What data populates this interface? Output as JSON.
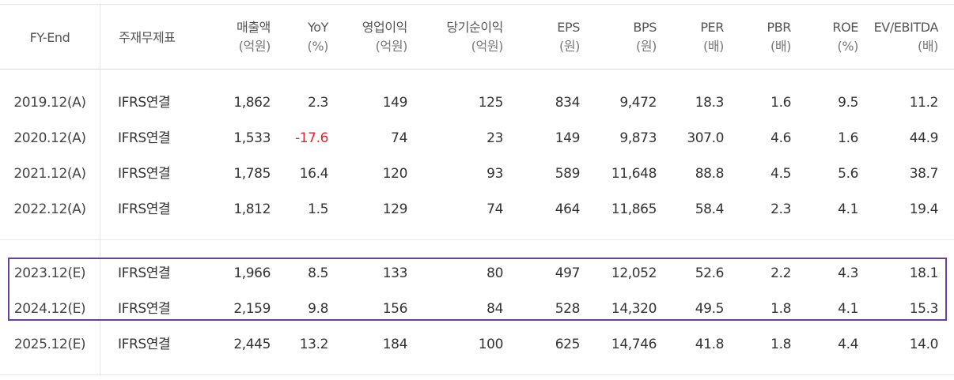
{
  "header": {
    "period": "FY-End",
    "standard": "주재무제표",
    "columns": [
      {
        "label": "매출액",
        "unit": "(억원)"
      },
      {
        "label": "YoY",
        "unit": "(%)"
      },
      {
        "label": "영업이익",
        "unit": "(억원)"
      },
      {
        "label": "당기순이익",
        "unit": "(억원)"
      },
      {
        "label": "EPS",
        "unit": "(원)"
      },
      {
        "label": "BPS",
        "unit": "(원)"
      },
      {
        "label": "PER",
        "unit": "(배)"
      },
      {
        "label": "PBR",
        "unit": "(배)"
      },
      {
        "label": "ROE",
        "unit": "(%)"
      },
      {
        "label": "EV/EBITDA",
        "unit": "(배)"
      }
    ]
  },
  "rows": [
    {
      "period": "2019.12(A)",
      "standard": "IFRS연결",
      "values": [
        "1,862",
        "2.3",
        "149",
        "125",
        "834",
        "9,472",
        "18.3",
        "1.6",
        "9.5",
        "11.2"
      ]
    },
    {
      "period": "2020.12(A)",
      "standard": "IFRS연결",
      "values": [
        "1,533",
        "-17.6",
        "74",
        "23",
        "149",
        "9,873",
        "307.0",
        "4.6",
        "1.6",
        "44.9"
      ]
    },
    {
      "period": "2021.12(A)",
      "standard": "IFRS연결",
      "values": [
        "1,785",
        "16.4",
        "120",
        "93",
        "589",
        "11,648",
        "88.8",
        "4.5",
        "5.6",
        "38.7"
      ]
    },
    {
      "period": "2022.12(A)",
      "standard": "IFRS연결",
      "values": [
        "1,812",
        "1.5",
        "129",
        "74",
        "464",
        "11,865",
        "58.4",
        "2.3",
        "4.1",
        "19.4"
      ]
    },
    {
      "period": "2023.12(E)",
      "standard": "IFRS연결",
      "values": [
        "1,966",
        "8.5",
        "133",
        "80",
        "497",
        "12,052",
        "52.6",
        "2.2",
        "4.3",
        "18.1"
      ]
    },
    {
      "period": "2024.12(E)",
      "standard": "IFRS연결",
      "values": [
        "2,159",
        "9.8",
        "156",
        "84",
        "528",
        "14,320",
        "49.5",
        "1.8",
        "4.1",
        "15.3"
      ]
    },
    {
      "period": "2025.12(E)",
      "standard": "IFRS연결",
      "values": [
        "2,445",
        "13.2",
        "184",
        "100",
        "625",
        "14,746",
        "41.8",
        "1.8",
        "4.4",
        "14.0"
      ]
    }
  ],
  "highlighted_rows": [
    "2023.12(E)",
    "2024.12(E)"
  ],
  "colors": {
    "negative": "#e0272d",
    "highlight_border": "#6a3fa0",
    "grid_line": "#e3e3e3"
  }
}
